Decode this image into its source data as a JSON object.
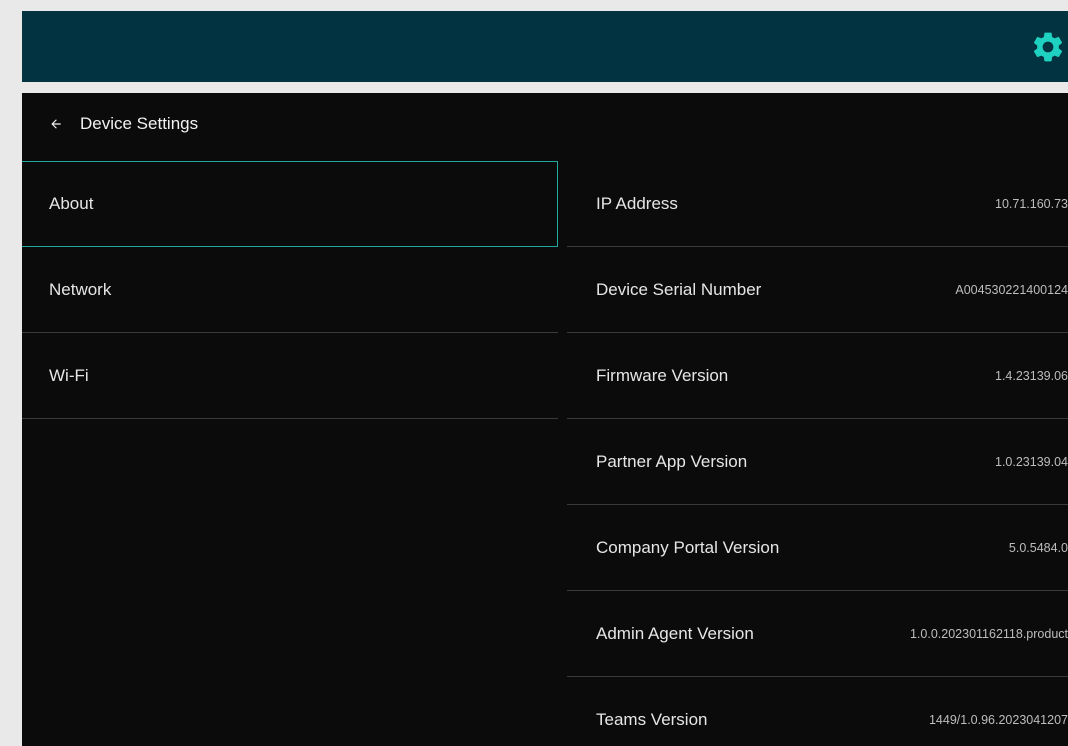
{
  "topbar": {
    "settings_icon": "gear-icon",
    "accent_color": "#1fd1c1",
    "background_color": "#013440"
  },
  "header": {
    "back_icon": "arrow-left-icon",
    "title": "Device Settings"
  },
  "nav": {
    "items": [
      {
        "label": "About",
        "active": true
      },
      {
        "label": "Network",
        "active": false
      },
      {
        "label": "Wi-Fi",
        "active": false
      }
    ]
  },
  "about": {
    "rows": [
      {
        "label": "IP Address",
        "value": "10.71.160.73"
      },
      {
        "label": "Device Serial Number",
        "value": "A004530221400124"
      },
      {
        "label": "Firmware Version",
        "value": "1.4.23139.06"
      },
      {
        "label": "Partner App Version",
        "value": "1.0.23139.04"
      },
      {
        "label": "Company Portal Version",
        "value": "5.0.5484.0"
      },
      {
        "label": "Admin Agent Version",
        "value": "1.0.0.202301162118.product"
      },
      {
        "label": "Teams Version",
        "value": "1449/1.0.96.2023041207"
      }
    ]
  }
}
